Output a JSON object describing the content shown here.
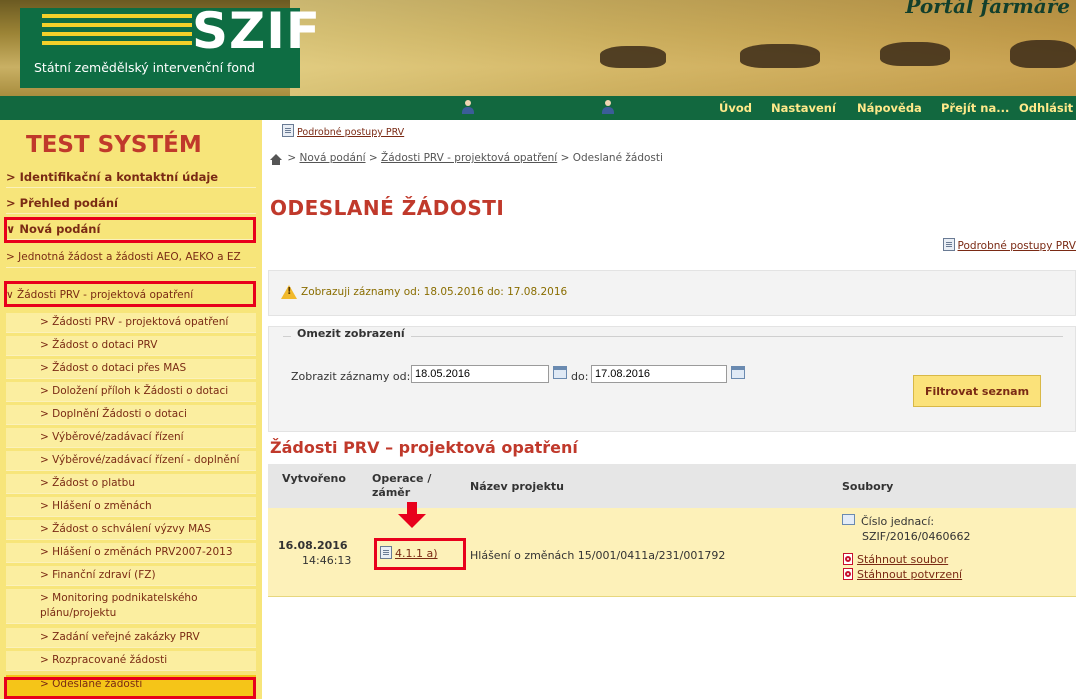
{
  "header": {
    "logo_text": "SZIF",
    "logo_subtitle": "Státní zemědělský intervenční fond",
    "portal_title": "Portál farmáře"
  },
  "topnav": {
    "items": [
      "Úvod",
      "Nastavení",
      "Nápověda",
      "Přejít na...",
      "Odhlásit"
    ],
    "icons": [
      "user-icon",
      "user-icon"
    ]
  },
  "sidebar": {
    "system_title": "TEST SYSTÉM",
    "items": [
      {
        "label": "> Identifikační a kontaktní údaje",
        "level": 1
      },
      {
        "label": "> Přehled podání",
        "level": 1
      },
      {
        "label": "∨ Nová podání",
        "level": 1,
        "highlighted": true
      },
      {
        "label": "> Jednotná žádost a žádosti AEO, AEKO a EZ",
        "level": 2
      },
      {
        "label": "∨ Žádosti PRV - projektová opatření",
        "level": 2,
        "highlighted": true
      },
      {
        "label": "> Žádosti PRV - projektová opatření",
        "level": 3
      },
      {
        "label": "> Žádost o dotaci PRV",
        "level": 3
      },
      {
        "label": "> Žádost o dotaci přes MAS",
        "level": 3
      },
      {
        "label": "> Doložení příloh k Žádosti o dotaci",
        "level": 3
      },
      {
        "label": "> Doplnění Žádosti o dotaci",
        "level": 3
      },
      {
        "label": "> Výběrové/zadávací řízení",
        "level": 3
      },
      {
        "label": "> Výběrové/zadávací řízení - doplnění",
        "level": 3
      },
      {
        "label": "> Žádost o platbu",
        "level": 3
      },
      {
        "label": "> Hlášení o změnách",
        "level": 3
      },
      {
        "label": "> Žádost o schválení výzvy MAS",
        "level": 3
      },
      {
        "label": "> Hlášení o změnách PRV2007-2013",
        "level": 3
      },
      {
        "label": "> Finanční zdraví (FZ)",
        "level": 3
      },
      {
        "label": "> Monitoring podnikatelského plánu/projektu",
        "level": 3
      },
      {
        "label": "> Zadání veřejné zakázky PRV",
        "level": 3
      },
      {
        "label": "> Rozpracované žádosti",
        "level": 3
      },
      {
        "label": "> Odeslané žádosti",
        "level": 3,
        "active": true,
        "highlighted": true
      }
    ]
  },
  "main": {
    "top_link": "Podrobné postupy PRV",
    "breadcrumb": {
      "items": [
        "Nová podání",
        "Žádosti PRV - projektová opatření"
      ],
      "separator": ">",
      "current": "Odeslané žádosti"
    },
    "page_title": "ODESLANÉ ŽÁDOSTI",
    "right_link": "Podrobné postupy PRV",
    "notice": "Zobrazuji záznamy od: 18.05.2016 do: 17.08.2016",
    "filter": {
      "legend": "Omezit zobrazení",
      "from_label": "Zobrazit záznamy od:",
      "from_value": "18.05.2016",
      "to_label": "do:",
      "to_value": "17.08.2016",
      "button": "Filtrovat seznam"
    },
    "section_title": "Žádosti PRV – projektová opatření",
    "table": {
      "headers": [
        "Vytvořeno",
        "Operace / záměr",
        "Název projektu",
        "Soubory"
      ],
      "rows": [
        {
          "date": "16.08.2016",
          "time": "14:46:13",
          "operation": "4.1.1 a)",
          "project_name": "Hlášení o změnách 15/001/0411a/231/001792",
          "ref_label": "Číslo jednací:",
          "ref_value": "SZIF/2016/0460662",
          "file_links": [
            "Stáhnout soubor",
            "Stáhnout potvrzení"
          ]
        }
      ]
    }
  },
  "colors": {
    "accent_red": "#c0392b",
    "highlight_red": "#e8001c",
    "nav_green": "#12683f",
    "sidebar_yellow": "#f7e57a",
    "active_yellow": "#f5c518"
  }
}
